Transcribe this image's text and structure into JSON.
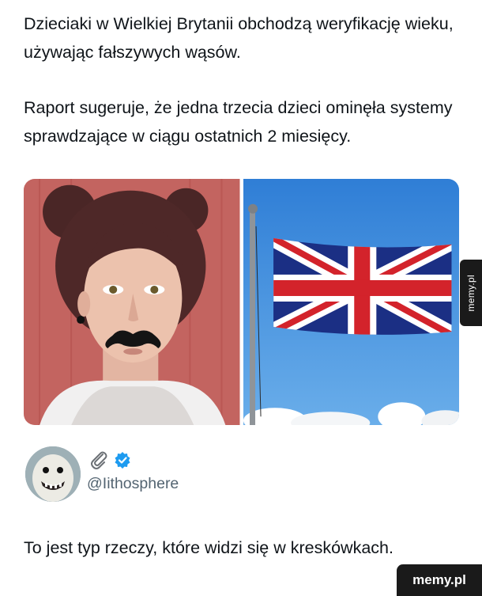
{
  "post": {
    "line1": "Dzieciaki w Wielkiej Brytanii obchodzą weryfikację wieku, używając fałszywych wąsów.",
    "line2": "Raport sugeruje, że jedna trzecia dzieci ominęła systemy sprawdzające w ciągu ostatnich 2 miesięcy."
  },
  "media": {
    "left_image": "girl-with-fake-mustache",
    "right_image": "union-jack-flag"
  },
  "side_tab": {
    "label": "memy.pl"
  },
  "author": {
    "handle": "@Iithosphere",
    "icons": [
      "paperclip-icon",
      "verified-badge-icon"
    ],
    "accent_color": "#1d9bf0"
  },
  "reply": {
    "text": "To jest typ rzeczy, które widzi się w kreskówkach."
  },
  "watermark": {
    "label": "memy.pl"
  }
}
